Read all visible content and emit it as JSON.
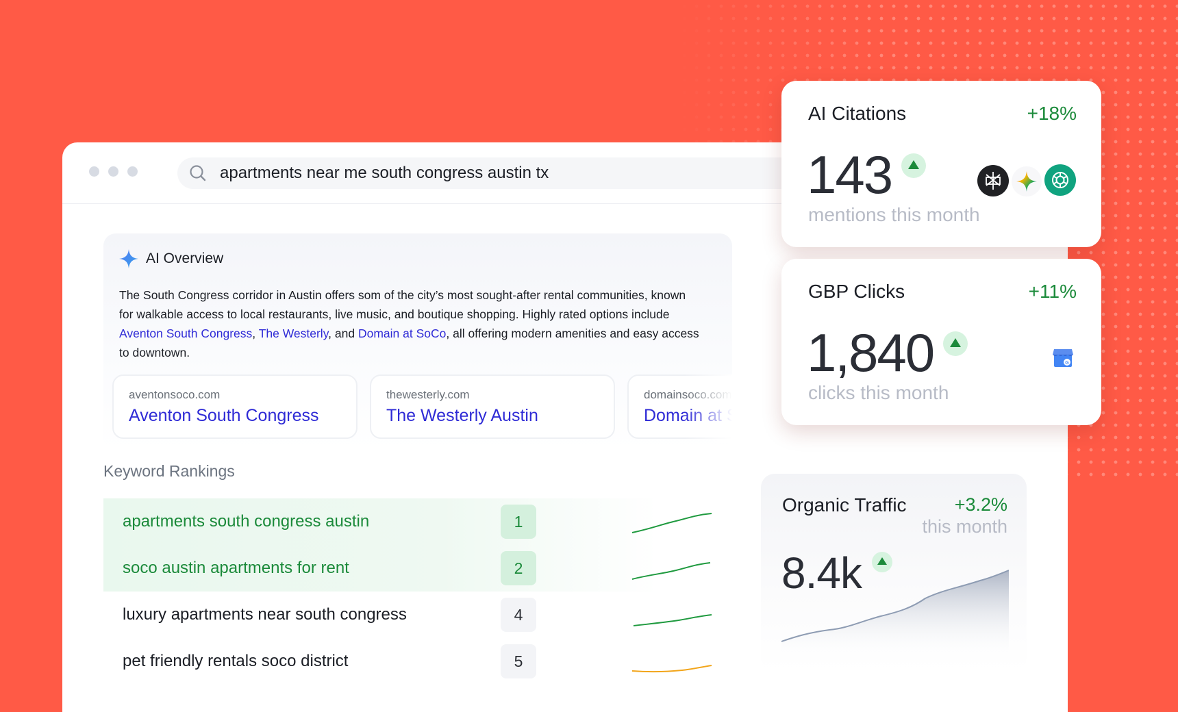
{
  "search": {
    "query": "apartments near me south congress austin tx"
  },
  "ai_overview": {
    "title": "AI Overview",
    "text_before": "The South Congress corridor in Austin offers som of the city’s most sought-after rental communities, known for walkable access to local restaurants, live music, and boutique shopping. Highly rated options include ",
    "link1": "Aventon South Congress",
    "sep1": ", ",
    "link2": "The Westerly",
    "sep2": ", and ",
    "link3": "Domain at SoCo",
    "text_after": ", all offering modern amenities and easy access to downtown.",
    "sources": [
      {
        "domain": "aventonsoco.com",
        "name": "Aventon South Congress"
      },
      {
        "domain": "thewesterly.com",
        "name": "The Westerly Austin"
      },
      {
        "domain": "domainsoco.com",
        "name": "Domain at SoCo"
      }
    ]
  },
  "keyword_rankings": {
    "title": "Keyword Rankings",
    "rows": [
      {
        "keyword": "apartments south congress austin",
        "rank": "1",
        "trend_color": "#1f9a3f"
      },
      {
        "keyword": "soco austin apartments for rent",
        "rank": "2",
        "trend_color": "#1f9a3f"
      },
      {
        "keyword": "luxury apartments near south congress",
        "rank": "4",
        "trend_color": "#1f9a3f"
      },
      {
        "keyword": "pet friendly rentals soco district",
        "rank": "5",
        "trend_color": "#f2a51a"
      }
    ]
  },
  "ai_citations": {
    "label": "AI Citations",
    "delta": "+18%",
    "value": "143",
    "sub": "mentions this month",
    "icons": [
      "perplexity-icon",
      "gemini-icon",
      "chatgpt-icon"
    ]
  },
  "gbp_clicks": {
    "label": "GBP Clicks",
    "delta": "+11%",
    "value": "1,840",
    "sub": "clicks this month",
    "icons": [
      "google-business-profile-icon"
    ]
  },
  "organic_traffic": {
    "label": "Organic Traffic",
    "delta": "+3.2%",
    "sub": "this month",
    "value": "8.4k"
  },
  "colors": {
    "background": "#ff5a46",
    "link": "#2f2bd6",
    "positive": "#1b8a3a",
    "muted": "#b7bbc6"
  }
}
